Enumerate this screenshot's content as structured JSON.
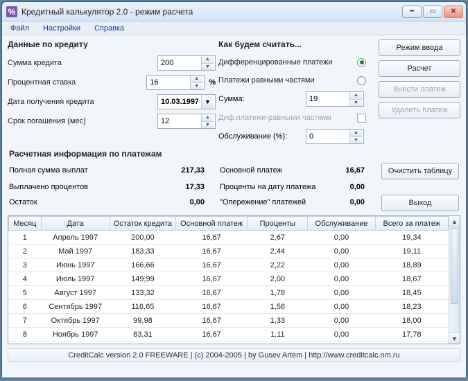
{
  "window": {
    "icon_char": "%",
    "title": "Кредитный калькулятор 2.0 - режим расчета"
  },
  "menu": {
    "file": "Файл",
    "settings": "Настройки",
    "help": "Справка"
  },
  "left": {
    "heading": "Данные по кредиту",
    "sum_label": "Сумма кредита",
    "sum_value": "200",
    "rate_label": "Процентная ставка",
    "rate_value": "16",
    "rate_unit": "%",
    "date_label": "Дата получения кредита",
    "date_value": "10.03.1997",
    "term_label": "Срок погашения (мес)",
    "term_value": "12"
  },
  "mid": {
    "heading": "Как будем считать...",
    "opt_diff": "Дифференцированные платежи",
    "opt_eq": "Платежи равными частями",
    "sum_label": "Сумма:",
    "sum_value": "19",
    "diffeq_label": "Диф.платежи-равными частями",
    "service_label": "Обслуживание (%):",
    "service_value": "0"
  },
  "buttons": {
    "mode": "Режим ввода",
    "calc": "Расчет",
    "pay": "Внести платеж",
    "del": "Удалить платеж",
    "clear": "Очистить таблицу",
    "exit": "Выход"
  },
  "info": {
    "heading": "Расчетная информация по платежам",
    "total_label": "Полная сумма выплат",
    "total_val": "217,33",
    "interest_label": "Выплачено процентов",
    "interest_val": "17,33",
    "rest_label": "Остаток",
    "rest_val": "0,00",
    "principal_label": "Основной платеж",
    "principal_val": "16,67",
    "percent_label": "Проценты на дату платежа",
    "percent_val": "0,00",
    "ahead_label": "\"Опережение\" платежей",
    "ahead_val": "0,00"
  },
  "table": {
    "cols": [
      "Месяц",
      "Дата",
      "Остаток кредита",
      "Основной платеж",
      "Проценты",
      "Обслуживание",
      "Всего за платеж"
    ],
    "rows": [
      [
        "1",
        "Апрель 1997",
        "200,00",
        "16,67",
        "2,67",
        "0,00",
        "19,34"
      ],
      [
        "2",
        "Май 1997",
        "183,33",
        "16,67",
        "2,44",
        "0,00",
        "19,11"
      ],
      [
        "3",
        "Июнь 1997",
        "166,66",
        "16,67",
        "2,22",
        "0,00",
        "18,89"
      ],
      [
        "4",
        "Июль 1997",
        "149,99",
        "16,67",
        "2,00",
        "0,00",
        "18,67"
      ],
      [
        "5",
        "Август 1997",
        "133,32",
        "16,67",
        "1,78",
        "0,00",
        "18,45"
      ],
      [
        "6",
        "Сентябрь 1997",
        "116,65",
        "16,67",
        "1,56",
        "0,00",
        "18,23"
      ],
      [
        "7",
        "Октябрь 1997",
        "99,98",
        "16,67",
        "1,33",
        "0,00",
        "18,00"
      ],
      [
        "8",
        "Ноябрь 1997",
        "83,31",
        "16,67",
        "1,11",
        "0,00",
        "17,78"
      ]
    ]
  },
  "status": "CreditCalc version 2.0  FREEWARE   |   (c) 2004-2005   |   by Gusev Artem   |   http://www.creditcalc.nm.ru"
}
